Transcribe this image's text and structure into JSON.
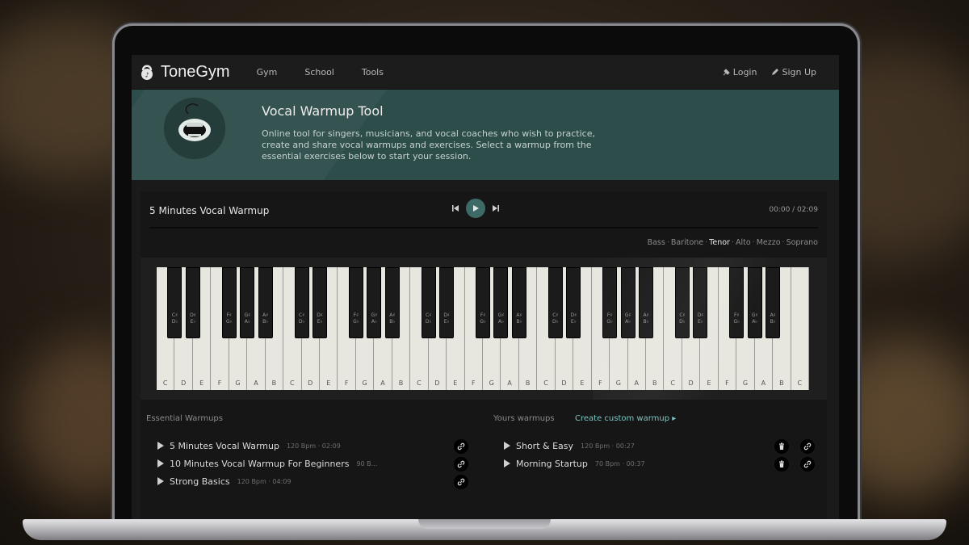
{
  "app": {
    "brand": "ToneGym"
  },
  "nav": {
    "links": [
      "Gym",
      "School",
      "Tools"
    ],
    "login": "Login",
    "signup": "Sign Up"
  },
  "hero": {
    "title": "Vocal Warmup Tool",
    "description": "Online tool for singers, musicians, and vocal coaches who wish to practice, create and share vocal warmups and exercises. Select a warmup from the essential exercises below to start your session."
  },
  "player": {
    "title": "5 Minutes Vocal Warmup",
    "time": "00:00 / 02:09",
    "progress": 0,
    "voices": [
      "Bass",
      "Baritone",
      "Tenor",
      "Alto",
      "Mezzo",
      "Soprano"
    ],
    "active_voice": "Tenor"
  },
  "piano": {
    "white_keys": [
      "C",
      "D",
      "E",
      "F",
      "G",
      "A",
      "B",
      "C",
      "D",
      "E",
      "F",
      "G",
      "A",
      "B",
      "C",
      "D",
      "E",
      "F",
      "G",
      "A",
      "B",
      "C",
      "D",
      "E",
      "F",
      "G",
      "A",
      "B",
      "C",
      "D",
      "E",
      "F",
      "G",
      "A",
      "B",
      "C"
    ],
    "black_keys": [
      [
        "C♯",
        "D♭"
      ],
      [
        "D♯",
        "E♭"
      ],
      [
        "F♯",
        "G♭"
      ],
      [
        "G♯",
        "A♭"
      ],
      [
        "A♯",
        "B♭"
      ],
      [
        "C♯",
        "D♭"
      ],
      [
        "D♯",
        "E♭"
      ],
      [
        "F♯",
        "G♭"
      ],
      [
        "G♯",
        "A♭"
      ],
      [
        "A♯",
        "B♭"
      ],
      [
        "C♯",
        "D♭"
      ],
      [
        "D♯",
        "E♭"
      ],
      [
        "F♯",
        "G♭"
      ],
      [
        "G♯",
        "A♭"
      ],
      [
        "A♯",
        "B♭"
      ],
      [
        "C♯",
        "D♭"
      ],
      [
        "D♯",
        "E♭"
      ],
      [
        "F♯",
        "G♭"
      ],
      [
        "G♯",
        "A♭"
      ],
      [
        "A♯",
        "B♭"
      ],
      [
        "C♯",
        "D♭"
      ],
      [
        "D♯",
        "E♭"
      ],
      [
        "F♯",
        "G♭"
      ],
      [
        "G♯",
        "A♭"
      ],
      [
        "A♯",
        "B♭"
      ]
    ]
  },
  "essential": {
    "label": "Essential Warmups",
    "items": [
      {
        "name": "5 Minutes Vocal Warmup",
        "meta": "120 Bpm · 02:09"
      },
      {
        "name": "10 Minutes Vocal Warmup For Beginners",
        "meta": "90 B..."
      },
      {
        "name": "Strong Basics",
        "meta": "120 Bpm · 04:09"
      }
    ]
  },
  "yours": {
    "label": "Yours warmups",
    "create_label": "Create custom warmup",
    "items": [
      {
        "name": "Short & Easy",
        "meta": "120 Bpm · 00:27"
      },
      {
        "name": "Morning Startup",
        "meta": "70 Bpm · 00:37"
      }
    ]
  },
  "colors": {
    "accent": "#3d6a66",
    "hero_bg": "#2d4d4a",
    "link": "#7cc4c0"
  }
}
